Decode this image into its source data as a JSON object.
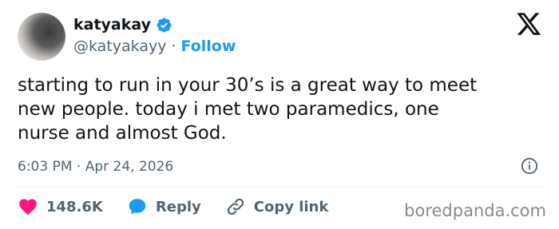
{
  "user": {
    "display_name": "katyakay",
    "handle": "@katyakayy",
    "separator": "·",
    "follow_label": "Follow"
  },
  "tweet": {
    "text": "starting to run in your 30’s is a great way to meet\nnew people. today i met two paramedics, one\nnurse and almost God.",
    "timestamp": "6:03 PM · Apr 24, 2026"
  },
  "actions": {
    "likes": "148.6K",
    "reply_label": "Reply",
    "copy_label": "Copy link"
  },
  "watermark": "boredpanda.com",
  "colors": {
    "accent": "#1d9bf0",
    "like": "#f91880",
    "text": "#0f1419",
    "secondary": "#536471"
  },
  "icons": [
    "verified-badge-icon",
    "x-logo-icon",
    "info-icon",
    "heart-icon",
    "reply-bubble-icon",
    "link-icon"
  ]
}
